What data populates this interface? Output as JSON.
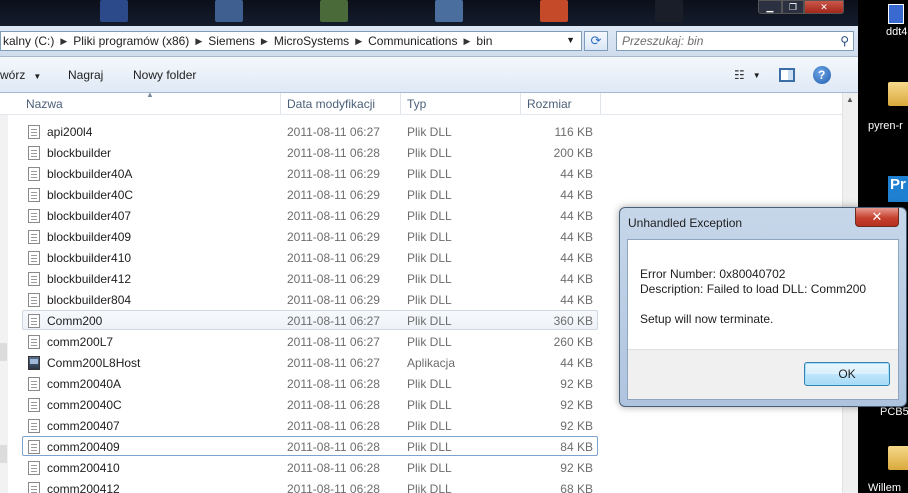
{
  "address": {
    "crumbs": [
      "kalny (C:)",
      "Pliki programów (x86)",
      "Siemens",
      "MicroSystems",
      "Communications",
      "bin"
    ],
    "search_placeholder": "Przeszukaj: bin"
  },
  "toolbar": {
    "organize_label": "wórz",
    "burn_label": "Nagraj",
    "new_folder_label": "Nowy folder"
  },
  "columns": {
    "name": "Nazwa",
    "date": "Data modyfikacji",
    "type": "Typ",
    "size": "Rozmiar"
  },
  "files": [
    {
      "name": "api200l4",
      "date": "2011-08-11 06:27",
      "type": "Plik DLL",
      "size": "116 KB"
    },
    {
      "name": "blockbuilder",
      "date": "2011-08-11 06:28",
      "type": "Plik DLL",
      "size": "200 KB"
    },
    {
      "name": "blockbuilder40A",
      "date": "2011-08-11 06:29",
      "type": "Plik DLL",
      "size": "44 KB"
    },
    {
      "name": "blockbuilder40C",
      "date": "2011-08-11 06:29",
      "type": "Plik DLL",
      "size": "44 KB"
    },
    {
      "name": "blockbuilder407",
      "date": "2011-08-11 06:29",
      "type": "Plik DLL",
      "size": "44 KB"
    },
    {
      "name": "blockbuilder409",
      "date": "2011-08-11 06:29",
      "type": "Plik DLL",
      "size": "44 KB"
    },
    {
      "name": "blockbuilder410",
      "date": "2011-08-11 06:29",
      "type": "Plik DLL",
      "size": "44 KB"
    },
    {
      "name": "blockbuilder412",
      "date": "2011-08-11 06:29",
      "type": "Plik DLL",
      "size": "44 KB"
    },
    {
      "name": "blockbuilder804",
      "date": "2011-08-11 06:29",
      "type": "Plik DLL",
      "size": "44 KB"
    },
    {
      "name": "Comm200",
      "date": "2011-08-11 06:27",
      "type": "Plik DLL",
      "size": "360 KB"
    },
    {
      "name": "comm200L7",
      "date": "2011-08-11 06:27",
      "type": "Plik DLL",
      "size": "260 KB"
    },
    {
      "name": "Comm200L8Host",
      "date": "2011-08-11 06:27",
      "type": "Aplikacja",
      "size": "44 KB"
    },
    {
      "name": "comm20040A",
      "date": "2011-08-11 06:28",
      "type": "Plik DLL",
      "size": "92 KB"
    },
    {
      "name": "comm20040C",
      "date": "2011-08-11 06:28",
      "type": "Plik DLL",
      "size": "92 KB"
    },
    {
      "name": "comm200407",
      "date": "2011-08-11 06:28",
      "type": "Plik DLL",
      "size": "92 KB"
    },
    {
      "name": "comm200409",
      "date": "2011-08-11 06:28",
      "type": "Plik DLL",
      "size": "84 KB"
    },
    {
      "name": "comm200410",
      "date": "2011-08-11 06:28",
      "type": "Plik DLL",
      "size": "92 KB"
    },
    {
      "name": "comm200412",
      "date": "2011-08-11 06:28",
      "type": "Plik DLL",
      "size": "68 KB"
    }
  ],
  "desktop": {
    "labels": [
      "ddt4",
      "pyren-r",
      "Pr",
      "PCB5",
      "Willem"
    ]
  },
  "dialog": {
    "title": "Unhandled Exception",
    "close_glyph": "✕",
    "error_number": "Error Number: 0x80040702",
    "description": "Description: Failed to load DLL: Comm200",
    "setup_msg": "Setup will now terminate.",
    "ok_label": "OK"
  },
  "colors": {
    "selection_border": "#7da2ce",
    "dialog_frame": "#aec4de",
    "close_red": "#c6402e"
  }
}
